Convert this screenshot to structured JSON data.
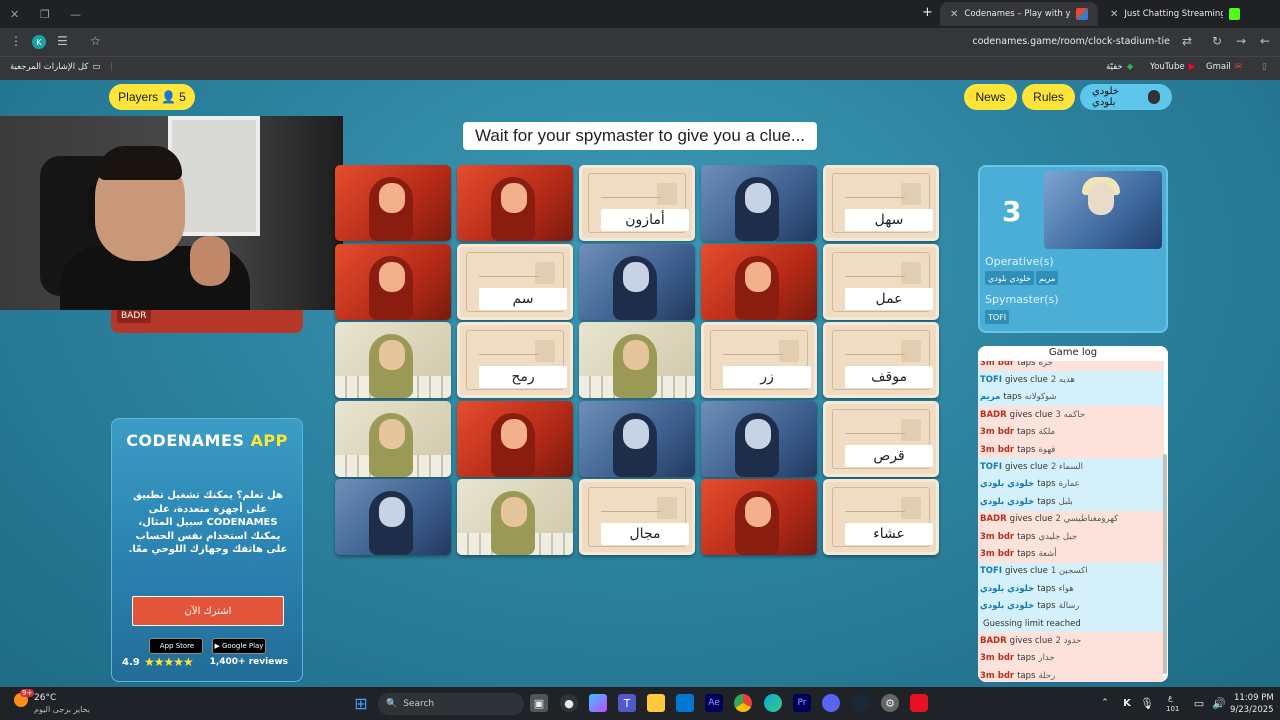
{
  "browser": {
    "tabs": [
      {
        "label": "Codenames – Play with your Fr",
        "active": true
      },
      {
        "label": "Just Chatting Streaming - Live",
        "active": false
      }
    ],
    "new_tab_symbol": "+",
    "url": "codenames.game/room/clock-stadium-tie",
    "profile_initial": "K",
    "bookmarks": {
      "all_label": "كل الإشارات المرجعية",
      "items": [
        "خفيّة",
        "YouTube",
        "Gmail"
      ]
    }
  },
  "header": {
    "players_label": "Players",
    "players_count": "5",
    "news_label": "News",
    "rules_label": "Rules",
    "user_name": "خلودي بلودي"
  },
  "clue_banner": "Wait for your spymaster to give you a clue...",
  "red_team": {
    "tag": "BADR"
  },
  "board": {
    "cards": [
      {
        "type": "red",
        "word": ""
      },
      {
        "type": "red",
        "word": ""
      },
      {
        "type": "word",
        "word": "أمازون"
      },
      {
        "type": "blue",
        "word": ""
      },
      {
        "type": "word",
        "word": "سهل"
      },
      {
        "type": "red",
        "word": ""
      },
      {
        "type": "word",
        "word": "سم"
      },
      {
        "type": "blue",
        "word": ""
      },
      {
        "type": "red",
        "word": ""
      },
      {
        "type": "word",
        "word": "عمل"
      },
      {
        "type": "neutral",
        "word": ""
      },
      {
        "type": "word",
        "word": "رمح"
      },
      {
        "type": "neutral",
        "word": ""
      },
      {
        "type": "word",
        "word": "زر"
      },
      {
        "type": "word",
        "word": "موقف"
      },
      {
        "type": "neutral",
        "word": ""
      },
      {
        "type": "red",
        "word": ""
      },
      {
        "type": "blue",
        "word": ""
      },
      {
        "type": "blue",
        "word": ""
      },
      {
        "type": "word",
        "word": "قرص"
      },
      {
        "type": "blue",
        "word": ""
      },
      {
        "type": "neutral",
        "word": ""
      },
      {
        "type": "word",
        "word": "مجال"
      },
      {
        "type": "red",
        "word": ""
      },
      {
        "type": "word",
        "word": "عشاء"
      }
    ]
  },
  "ad": {
    "title_main": "CODENAMES",
    "title_accent": "APP",
    "text": "هل تعلم؟ يمكنك تشغيل تطبيق على أجهزة متعددة، على CODENAMES سبيل المثال، يمكنك استخدام نفس الحساب على هاتفك وجهازك اللوحي معًا.",
    "button": "اشترك الآن",
    "app_store": "App Store",
    "google_play": "Google Play",
    "rating": "4.9",
    "stars": "★★★★★",
    "reviews": "1,400+ reviews"
  },
  "blue_team": {
    "score": "3",
    "operatives_label": "Operative(s)",
    "operatives": [
      "مريم",
      "خلودي بلودي"
    ],
    "spymaster_label": "Spymaster(s)",
    "spymasters": [
      "TOFI"
    ]
  },
  "game_log": {
    "title": "Game log",
    "rows": [
      {
        "team": "red",
        "who": "3m bdr",
        "action": "taps",
        "word": "جرة"
      },
      {
        "team": "blue",
        "who": "TOFI",
        "action": "gives clue",
        "word": "هديه 2"
      },
      {
        "team": "blue",
        "who": "مريم",
        "action": "taps",
        "word": "شوكولاته"
      },
      {
        "team": "red",
        "who": "BADR",
        "action": "gives clue",
        "word": "حاكمه 3"
      },
      {
        "team": "red",
        "who": "3m bdr",
        "action": "taps",
        "word": "ملكة"
      },
      {
        "team": "red",
        "who": "3m bdr",
        "action": "taps",
        "word": "قهوة"
      },
      {
        "team": "blue",
        "who": "TOFI",
        "action": "gives clue",
        "word": "السماء 2"
      },
      {
        "team": "blue",
        "who": "خلودي بلودي",
        "action": "taps",
        "word": "عمارة"
      },
      {
        "team": "blue",
        "who": "خلودي بلودي",
        "action": "taps",
        "word": "بلبل"
      },
      {
        "team": "red",
        "who": "BADR",
        "action": "gives clue",
        "word": "كهرومغناطيسي 2"
      },
      {
        "team": "red",
        "who": "3m bdr",
        "action": "taps",
        "word": "جبل جليدي"
      },
      {
        "team": "red",
        "who": "3m bdr",
        "action": "taps",
        "word": "أشعة"
      },
      {
        "team": "blue",
        "who": "TOFI",
        "action": "gives clue",
        "word": "اكسجين 1"
      },
      {
        "team": "blue",
        "who": "خلودي بلودي",
        "action": "taps",
        "word": "هواء"
      },
      {
        "team": "blue",
        "who": "خلودي بلودي",
        "action": "taps",
        "word": "رسالة"
      },
      {
        "team": "blue",
        "who": "",
        "action": "Guessing limit reached",
        "word": ""
      },
      {
        "team": "red",
        "who": "BADR",
        "action": "gives clue",
        "word": "حدود 2"
      },
      {
        "team": "red",
        "who": "3m bdr",
        "action": "taps",
        "word": "جدار"
      },
      {
        "team": "red",
        "who": "3m bdr",
        "action": "taps",
        "word": "رحلة"
      }
    ]
  },
  "taskbar": {
    "weather_temp": "26°C",
    "weather_desc": "بحاير برجى اليوم",
    "badge": "9+",
    "search_label": "Search",
    "lang": "ع",
    "lang_sub": "101",
    "time": "11:09 PM",
    "date": "9/23/2025"
  },
  "colors": {
    "pill_yellow": "#ffe43a",
    "user_pill": "#5ec6ea",
    "red_team": "#b5372a",
    "blue_team": "#4aaed6"
  }
}
